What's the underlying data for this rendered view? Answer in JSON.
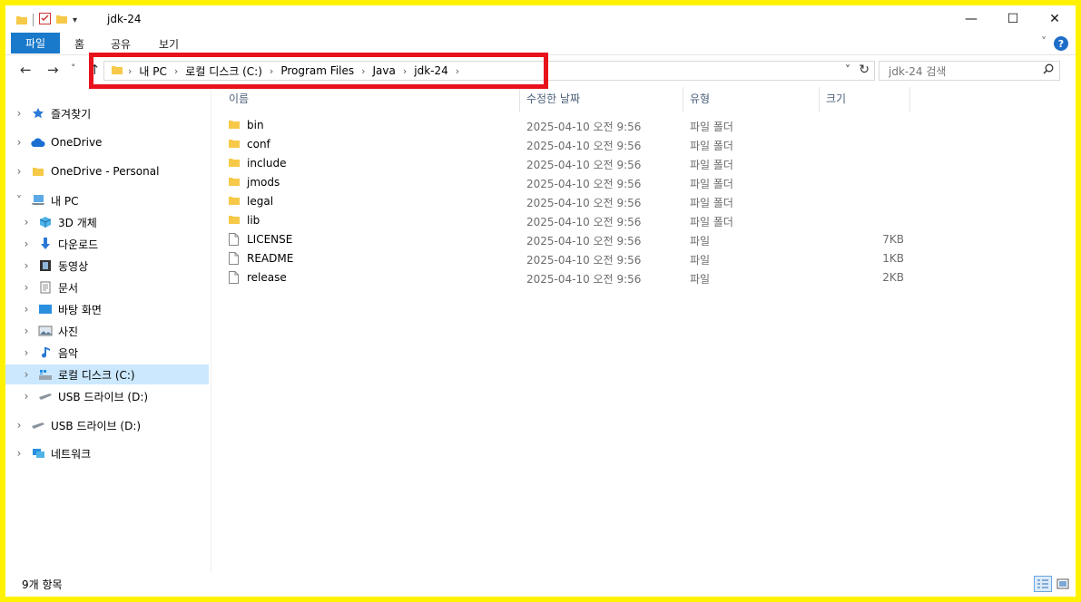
{
  "window": {
    "title": "jdk-24",
    "minimize": "—",
    "maximize": "☐",
    "close": "✕"
  },
  "ribbon": {
    "tabs": [
      "파일",
      "홈",
      "공유",
      "보기"
    ],
    "help": "?"
  },
  "nav": {
    "back": "←",
    "forward": "→",
    "recent": "˅",
    "up": "↑"
  },
  "address": {
    "breadcrumbs": [
      "내 PC",
      "로컬 디스크 (C:)",
      "Program Files",
      "Java",
      "jdk-24"
    ],
    "separator": "›"
  },
  "search": {
    "placeholder": "jdk-24 검색"
  },
  "sidebar": {
    "items": [
      {
        "label": "즐겨찾기",
        "icon": "star-icon"
      },
      {
        "label": "OneDrive",
        "icon": "cloud-icon"
      },
      {
        "label": "OneDrive - Personal",
        "icon": "folder-icon"
      },
      {
        "label": "내 PC",
        "icon": "pc-icon"
      },
      {
        "label": "3D 개체",
        "icon": "cube-icon"
      },
      {
        "label": "다운로드",
        "icon": "download-icon"
      },
      {
        "label": "동영상",
        "icon": "film-icon"
      },
      {
        "label": "문서",
        "icon": "document-icon"
      },
      {
        "label": "바탕 화면",
        "icon": "desktop-icon"
      },
      {
        "label": "사진",
        "icon": "picture-icon"
      },
      {
        "label": "음악",
        "icon": "music-icon"
      },
      {
        "label": "로컬 디스크 (C:)",
        "icon": "drive-icon"
      },
      {
        "label": "USB 드라이브 (D:)",
        "icon": "usb-drive-icon"
      },
      {
        "label": "USB 드라이브 (D:)",
        "icon": "usb-drive-icon"
      },
      {
        "label": "네트워크",
        "icon": "network-icon"
      }
    ]
  },
  "columns": [
    "이름",
    "수정한 날짜",
    "유형",
    "크기"
  ],
  "files": [
    {
      "name": "bin",
      "date": "2025-04-10 오전 9:56",
      "type": "파일 폴더",
      "size": "",
      "kind": "folder"
    },
    {
      "name": "conf",
      "date": "2025-04-10 오전 9:56",
      "type": "파일 폴더",
      "size": "",
      "kind": "folder"
    },
    {
      "name": "include",
      "date": "2025-04-10 오전 9:56",
      "type": "파일 폴더",
      "size": "",
      "kind": "folder"
    },
    {
      "name": "jmods",
      "date": "2025-04-10 오전 9:56",
      "type": "파일 폴더",
      "size": "",
      "kind": "folder"
    },
    {
      "name": "legal",
      "date": "2025-04-10 오전 9:56",
      "type": "파일 폴더",
      "size": "",
      "kind": "folder"
    },
    {
      "name": "lib",
      "date": "2025-04-10 오전 9:56",
      "type": "파일 폴더",
      "size": "",
      "kind": "folder"
    },
    {
      "name": "LICENSE",
      "date": "2025-04-10 오전 9:56",
      "type": "파일",
      "size": "7KB",
      "kind": "file"
    },
    {
      "name": "README",
      "date": "2025-04-10 오전 9:56",
      "type": "파일",
      "size": "1KB",
      "kind": "file"
    },
    {
      "name": "release",
      "date": "2025-04-10 오전 9:56",
      "type": "파일",
      "size": "2KB",
      "kind": "file"
    }
  ],
  "status": {
    "count": "9개 항목"
  },
  "colors": {
    "accent": "#1979ca",
    "highlight": "#e8121c",
    "frame": "#fff200",
    "selected": "#cce8ff",
    "folder": "#f7c948"
  }
}
